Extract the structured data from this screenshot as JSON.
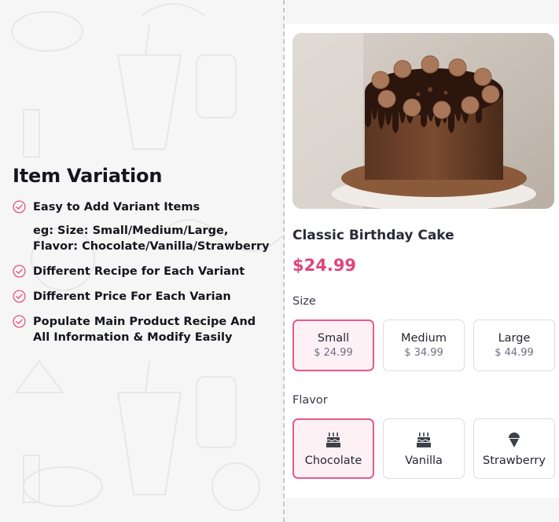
{
  "features": {
    "title": "Item Variation",
    "items": [
      {
        "lines": [
          "Easy to Add Variant Items"
        ]
      },
      {
        "lines": [
          "Different Recipe for Each Variant"
        ]
      },
      {
        "lines": [
          "Different Price For Each Varian"
        ]
      },
      {
        "lines": [
          "Populate Main Product Recipe And",
          "All Information & Modify Easily"
        ]
      }
    ],
    "example": {
      "line1": "eg: Size: Small/Medium/Large,",
      "line2": "Flavor: Chocolate/Vanilla/Strawberry"
    }
  },
  "product": {
    "image_icon": "chocolate-cake-photo",
    "name": "Classic Birthday Cake",
    "price": "$24.99",
    "accent_color": "#e0457b"
  },
  "size": {
    "label": "Size",
    "selected": "Small",
    "options": [
      {
        "name": "Small",
        "price": "$ 24.99"
      },
      {
        "name": "Medium",
        "price": "$ 34.99"
      },
      {
        "name": "Large",
        "price": "$ 44.99"
      }
    ]
  },
  "flavor": {
    "label": "Flavor",
    "selected": "Chocolate",
    "options": [
      {
        "name": "Chocolate",
        "icon": "cake-icon"
      },
      {
        "name": "Vanilla",
        "icon": "cake-icon"
      },
      {
        "name": "Strawberry",
        "icon": "ice-cream-icon"
      }
    ]
  }
}
